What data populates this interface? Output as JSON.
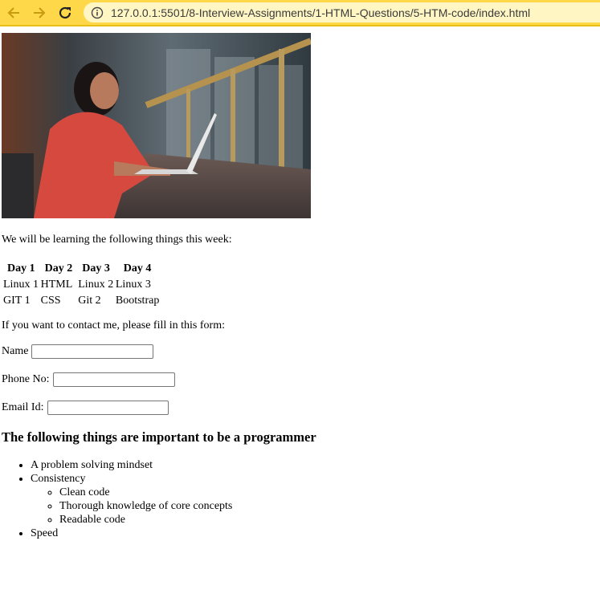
{
  "browser": {
    "url": "127.0.0.1:5501/8-Interview-Assignments/1-HTML-Questions/5-HTM-code/index.html",
    "back_icon": "back-arrow-icon",
    "forward_icon": "forward-arrow-icon",
    "reload_icon": "reload-icon",
    "info_icon": "info-icon"
  },
  "page": {
    "intro": "We will be learning the following things this week:",
    "schedule": {
      "headers": [
        "Day 1",
        "Day 2",
        "Day 3",
        "Day 4"
      ],
      "rows": [
        [
          "Linux 1",
          "HTML",
          "Linux 2",
          "Linux 3"
        ],
        [
          "GIT 1",
          "CSS",
          "Git 2",
          "Bootstrap"
        ]
      ]
    },
    "contact_prompt": "If you want to contact me, please fill in this form:",
    "form": {
      "name_label": "Name",
      "name_value": "",
      "phone_label": "Phone No:",
      "phone_value": "",
      "email_label": "Email Id:",
      "email_value": ""
    },
    "heading": "The following things are important to be a programmer",
    "list": {
      "item1": "A problem solving mindset",
      "item2": "Consistency",
      "sub1": "Clean code",
      "sub2": "Thorough knowledge of core concepts",
      "sub3": "Readable code",
      "item3": "Speed"
    }
  },
  "colors": {
    "toolbar": "#ffd84a",
    "omnibox": "#fff6c4"
  }
}
